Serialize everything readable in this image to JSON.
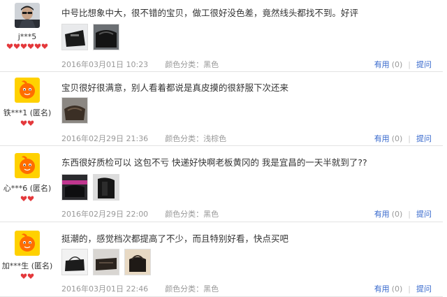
{
  "reviews": [
    {
      "username": "j***5",
      "text": "中号比想象中大，很不错的宝贝，做工很好没色差，竟然线头都找不到。好评",
      "date": "2016年03月01日 10:23",
      "variant": "颜色分类：黑色",
      "useful_label": "有用",
      "useful_count": "(0)",
      "ask_label": "提问"
    },
    {
      "username": "铁***1 (匿名)",
      "text": "宝贝很好很满意，别人看着都说是真皮摸的很舒服下次还来",
      "date": "2016年02月29日 21:36",
      "variant": "颜色分类：浅棕色",
      "useful_label": "有用",
      "useful_count": "(0)",
      "ask_label": "提问"
    },
    {
      "username": "心***6 (匿名)",
      "text": "东西很好质检可以 这包不亏 快递好快啊老板黄冈的 我是宜昌的一天半就到了??",
      "date": "2016年02月29日 22:00",
      "variant": "颜色分类：黑色",
      "useful_label": "有用",
      "useful_count": "(0)",
      "ask_label": "提问"
    },
    {
      "username": "加***生 (匿名)",
      "text": "挺潮的，感觉档次都提高了不少，而且特别好看，快点买吧",
      "date": "2016年03月01日 22:46",
      "variant": "颜色分类：黑色",
      "useful_label": "有用",
      "useful_count": "(0)",
      "ask_label": "提问"
    }
  ],
  "colors": {
    "link": "#3366cc",
    "meta": "#999999",
    "heart": "#e4393c",
    "avatar_bg": "#ffd100",
    "avatar_mascot": "#ff6d00"
  }
}
